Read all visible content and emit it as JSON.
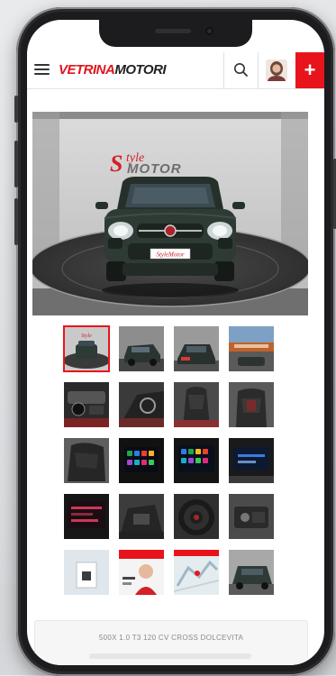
{
  "header": {
    "logo_part1": "VETRINA",
    "logo_part2": "MOTORI",
    "menu_icon": "hamburger-menu-icon",
    "search_icon": "search-icon",
    "avatar_icon": "user-avatar-icon",
    "add_label": "+"
  },
  "listing": {
    "dealer_watermark": "StyleMotor",
    "title": "500X 1.0 T3 120 CV CROSS DOLCEVITA"
  },
  "gallery": {
    "thumbnail_count": 20,
    "selected_index": 0
  },
  "colors": {
    "brand_red": "#e8141c",
    "car_body": "#2e3a34"
  }
}
